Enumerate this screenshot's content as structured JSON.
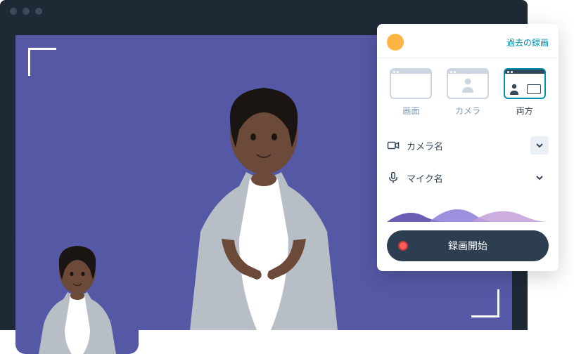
{
  "panel": {
    "past_recordings": "過去の録画",
    "modes": [
      {
        "label": "画面",
        "icon": "screen"
      },
      {
        "label": "カメラ",
        "icon": "camera"
      },
      {
        "label": "両方",
        "icon": "both",
        "selected": true
      }
    ],
    "camera_label": "カメラ名",
    "mic_label": "マイク名",
    "record_button": "録画開始"
  }
}
